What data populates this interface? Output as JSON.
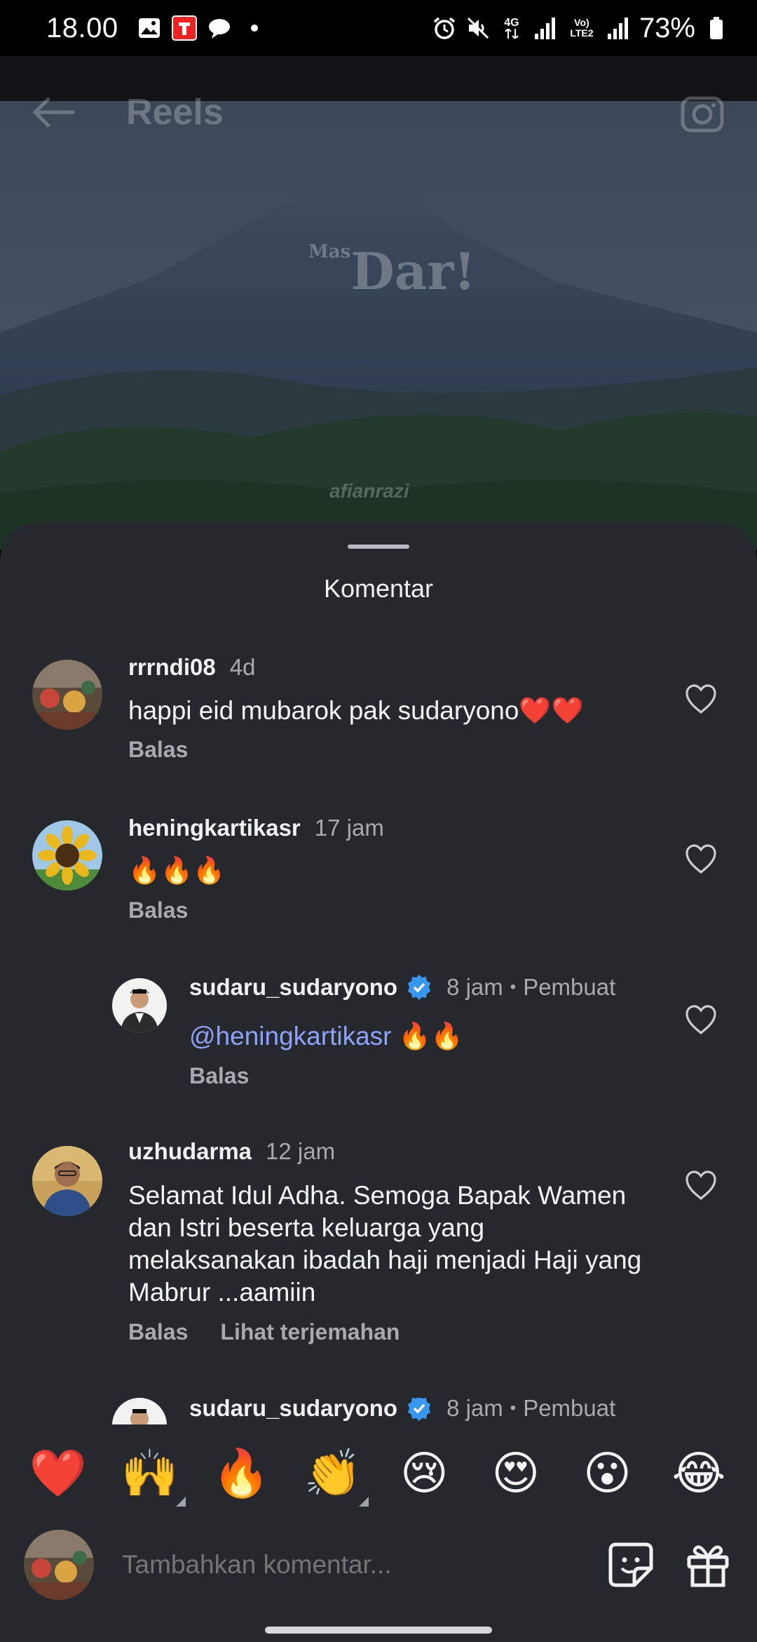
{
  "status_bar": {
    "time": "18.00",
    "battery": "73%",
    "network": "4G",
    "volte": "Vo) LTE2"
  },
  "reel": {
    "title": "Reels",
    "overlay_text": "Dar!",
    "overlay_small": "Mas",
    "watermark": "afianrazi"
  },
  "sheet": {
    "title": "Komentar"
  },
  "comments": [
    {
      "user": "rrrndi08",
      "time": "4d",
      "text": "happi eid mubarok pak sudaryono❤️❤️",
      "reply": "Balas"
    },
    {
      "user": "heningkartikasr",
      "time": "17 jam",
      "text": "🔥🔥🔥",
      "reply": "Balas"
    },
    {
      "user": "sudaru_sudaryono",
      "time": "8 jam",
      "author": "Pembuat",
      "mention": "@heningkartikasr",
      "text": " 🔥🔥",
      "reply": "Balas"
    },
    {
      "user": "uzhudarma",
      "time": "12 jam",
      "text": "Selamat Idul Adha. Semoga Bapak Wamen dan Istri beserta keluarga yang melaksanakan ibadah haji menjadi Haji yang Mabrur ...aamiin",
      "reply": "Balas",
      "translate": "Lihat terjemahan"
    },
    {
      "user": "sudaru_sudaryono",
      "time": "8 jam",
      "author": "Pembuat"
    }
  ],
  "reactions": [
    "❤️",
    "🙌",
    "🔥",
    "👏",
    "😢",
    "😍",
    "😮",
    "😂"
  ],
  "composer": {
    "placeholder": "Tambahkan komentar..."
  },
  "colors": {
    "sheet_bg": "#25292e",
    "mention": "#8ea1ff",
    "verified": "#3897f0"
  }
}
